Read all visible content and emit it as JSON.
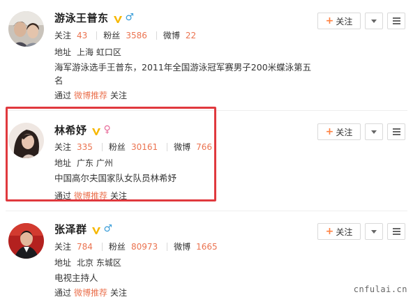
{
  "users": [
    {
      "name": "游泳王普东",
      "gender": "♂",
      "stats": [
        {
          "label": "关注",
          "value": "43"
        },
        {
          "label": "粉丝",
          "value": "3586"
        },
        {
          "label": "微博",
          "value": "22"
        }
      ],
      "location_label": "地址",
      "location": "上海 虹口区",
      "bio": "海军游泳选手王普东，2011年全国游泳冠军赛男子200米蝶泳第五名",
      "via_prefix": "通过",
      "via_link": "微博推荐",
      "via_suffix": "关注",
      "follow_label": "关注"
    },
    {
      "name": "林希妤",
      "gender": "♀",
      "stats": [
        {
          "label": "关注",
          "value": "335"
        },
        {
          "label": "粉丝",
          "value": "30161"
        },
        {
          "label": "微博",
          "value": "766"
        }
      ],
      "location_label": "地址",
      "location": "广东 广州",
      "bio": "中国高尔夫国家队女队员林希妤",
      "via_prefix": "通过",
      "via_link": "微博推荐",
      "via_suffix": "关注",
      "follow_label": "关注"
    },
    {
      "name": "张泽群",
      "gender": "♂",
      "stats": [
        {
          "label": "关注",
          "value": "784"
        },
        {
          "label": "粉丝",
          "value": "80973"
        },
        {
          "label": "微博",
          "value": "1665"
        }
      ],
      "location_label": "地址",
      "location": "北京 东城区",
      "bio": "电视主持人",
      "via_prefix": "通过",
      "via_link": "微博推荐",
      "via_suffix": "关注",
      "follow_label": "关注"
    }
  ],
  "watermark": "cnfulai.cn",
  "colors": {
    "accent": "#eb7350",
    "highlight": "#e0393e",
    "verified": "#f6b700",
    "male": "#3a9dd8",
    "female": "#e86c9a"
  }
}
